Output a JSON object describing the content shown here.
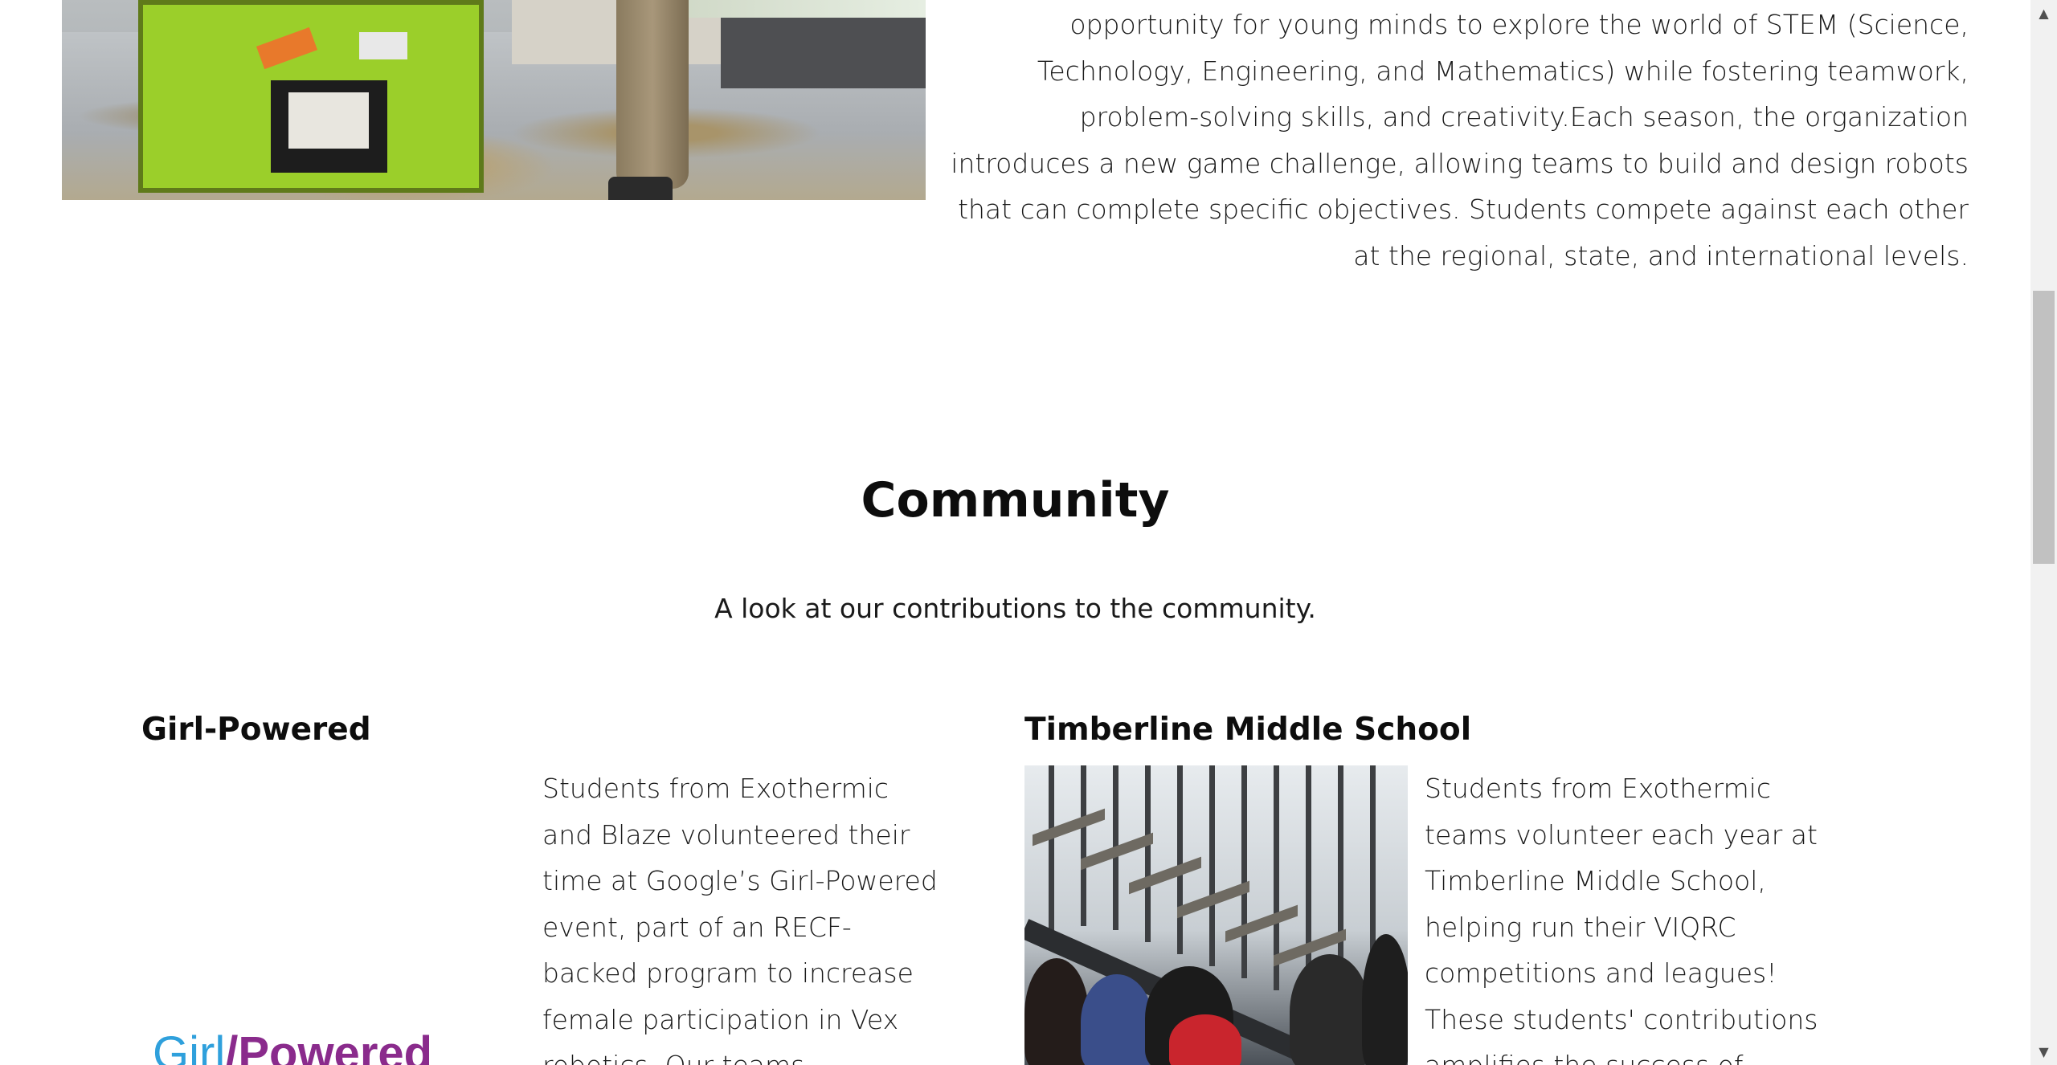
{
  "intro": {
    "paragraph": "opportunity for young minds to explore the world of STEM (Science, Technology, Engineering, and Mathematics) while fostering teamwork, problem-solving skills, and creativity.Each season, the organization introduces a new game challenge, allowing teams to build and design robots that can complete specific objectives. Students compete against each other at the regional, state, and international levels."
  },
  "community": {
    "title": "Community",
    "subtitle": "A look at our contributions to the community.",
    "cards": [
      {
        "title": "Girl-Powered",
        "text": "Students from Exothermic and Blaze volunteered their time at Google’s Girl-Powered event, part of an RECF-backed program to increase female participation in Vex robotics. Our teams"
      },
      {
        "title": "Timberline Middle School",
        "text": "Students from Exothermic teams volunteer each year at Timberline Middle School, helping run their VIQRC competitions and leagues! These students' contributions amplifies the success of"
      }
    ],
    "logo": {
      "part1": "Girl",
      "part2": "Powered"
    }
  },
  "icons": {
    "scroll_up": "scroll-up-icon",
    "scroll_down": "scroll-down-icon"
  },
  "colors": {
    "logo_blue": "#2fa0dc",
    "logo_purple": "#8a2b8c",
    "scroll_thumb": "#c1c1c1"
  }
}
